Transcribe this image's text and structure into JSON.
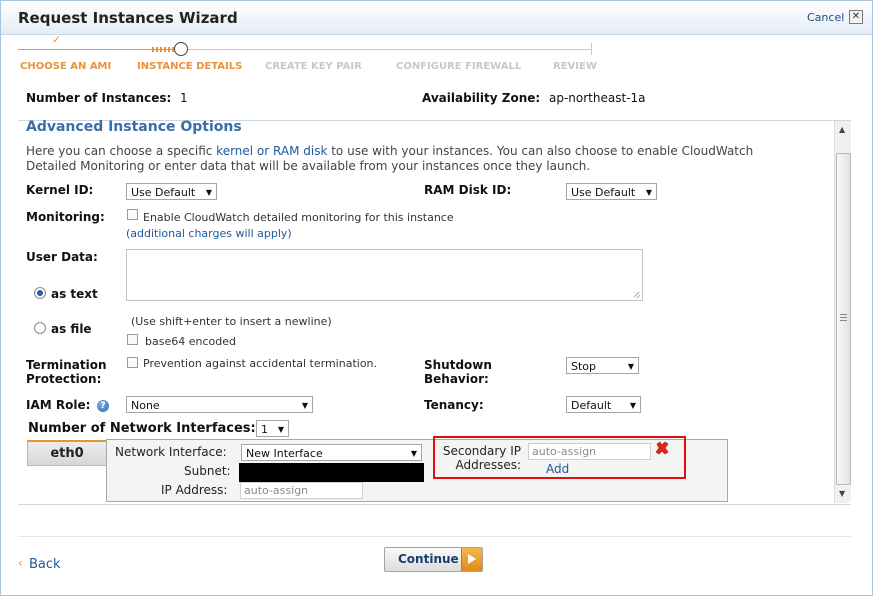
{
  "window": {
    "title": "Request Instances Wizard",
    "cancel_label": "Cancel",
    "close_glyph": "✕"
  },
  "wizard": {
    "steps": [
      {
        "label": "CHOOSE AN AMI",
        "state": "done"
      },
      {
        "label": "INSTANCE DETAILS",
        "state": "active"
      },
      {
        "label": "CREATE KEY PAIR",
        "state": "todo"
      },
      {
        "label": "CONFIGURE FIREWALL",
        "state": "todo"
      },
      {
        "label": "REVIEW",
        "state": "todo"
      }
    ],
    "done_mark": "✓",
    "accent_color": "#e8923a"
  },
  "summary": {
    "instances_label": "Number of Instances:",
    "instances_value": "1",
    "zone_label": "Availability Zone:",
    "zone_value": "ap-northeast-1a"
  },
  "advanced": {
    "heading": "Advanced Instance Options",
    "intro_pre": "Here you can choose a specific ",
    "intro_link": "kernel or RAM disk",
    "intro_post": " to use with your instances. You can also choose to enable CloudWatch",
    "intro_line2": "Detailed Monitoring or enter data that will be available from your instances once they launch.",
    "kernel_label": "Kernel ID:",
    "kernel_value": "Use Default",
    "ramdisk_label": "RAM Disk ID:",
    "ramdisk_value": "Use Default",
    "monitoring_label": "Monitoring:",
    "monitoring_checkbox": "Enable CloudWatch detailed monitoring for this instance",
    "monitoring_link": "(additional charges will apply)",
    "userdata_label": "User Data:",
    "as_text_label": "as text",
    "as_file_label": "as file",
    "userdata_hint": "(Use shift+enter to insert a newline)",
    "base64_label": "base64 encoded",
    "termination_label_1": "Termination",
    "termination_label_2": "Protection:",
    "termination_checkbox": "Prevention against accidental termination.",
    "shutdown_label_1": "Shutdown",
    "shutdown_label_2": "Behavior:",
    "shutdown_value": "Stop",
    "iam_label": "IAM Role:",
    "iam_value": "None",
    "tenancy_label": "Tenancy:",
    "tenancy_value": "Default",
    "nic_count_label": "Number of Network Interfaces:",
    "nic_count_value": "1"
  },
  "network": {
    "tab_label": "eth0",
    "interface_label": "Network Interface:",
    "interface_value": "New Interface",
    "subnet_label": "Subnet:",
    "ip_label": "IP Address:",
    "ip_placeholder": "auto-assign",
    "secondary_label_1": "Secondary IP",
    "secondary_label_2": "Addresses:",
    "secondary_placeholder": "auto-assign",
    "add_label": "Add",
    "highlight_color": "#e01010"
  },
  "footer": {
    "back_label": "Back",
    "back_glyph": "‹",
    "continue_label": "Continue"
  }
}
